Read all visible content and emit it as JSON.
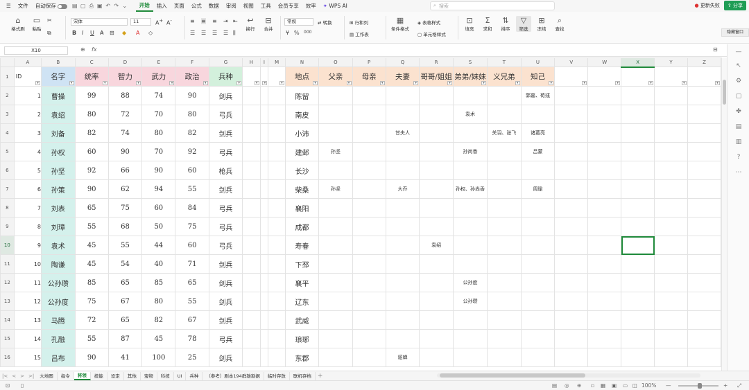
{
  "menubar": {
    "file": "文件",
    "autosave": "自动保存",
    "tabs": [
      "开始",
      "插入",
      "页面",
      "公式",
      "数据",
      "审阅",
      "视图",
      "工具",
      "会员专享",
      "效率"
    ],
    "active_tab": "开始",
    "wps_ai": "WPS AI",
    "search_placeholder": "搜索",
    "update_failed": "更新失败",
    "share": "分享"
  },
  "ribbon": {
    "format_painter": "格式刷",
    "paste": "粘贴",
    "font_name": "宋体",
    "font_size": "11",
    "wrap": "换行",
    "merge": "合并",
    "number_format": "常规",
    "convert": "转换",
    "rows_cols": "行和列",
    "worksheet": "工作表",
    "conditional_format": "条件格式",
    "table_style": "表格样式",
    "cell_style": "单元格样式",
    "fill": "填充",
    "sum": "求和",
    "sort": "排序",
    "filter": "筛选",
    "freeze": "冻结",
    "find": "查找",
    "hidden_window": "隐藏窗口"
  },
  "formula": {
    "namebox": "X10",
    "fx": "fx"
  },
  "columns": [
    "A",
    "B",
    "C",
    "D",
    "E",
    "F",
    "G",
    "H",
    "I",
    "M",
    "N",
    "O",
    "P",
    "Q",
    "R",
    "S",
    "T",
    "U",
    "V",
    "W",
    "X",
    "Y",
    "Z"
  ],
  "headers": {
    "id": "ID",
    "name": "名字",
    "lead": "统率",
    "int": "智力",
    "war": "武力",
    "pol": "政治",
    "troop": "兵种",
    "place": "地点",
    "father": "父亲",
    "mother": "母亲",
    "spouse": "夫妻",
    "elder": "哥哥/姐姐",
    "younger": "弟弟/妹妹",
    "sworn": "义兄弟",
    "confidant": "知己"
  },
  "rows": [
    {
      "r": "2",
      "id": "1",
      "name": "曹操",
      "lead": "99",
      "int": "88",
      "war": "74",
      "pol": "90",
      "troop": "剑兵",
      "place": "陈留",
      "father": "",
      "spouse": "",
      "elder": "",
      "younger": "",
      "sworn": "",
      "confidant": "郭嘉、荀彧"
    },
    {
      "r": "3",
      "id": "2",
      "name": "袁绍",
      "lead": "80",
      "int": "72",
      "war": "70",
      "pol": "80",
      "troop": "弓兵",
      "place": "南皮",
      "father": "",
      "spouse": "",
      "elder": "",
      "younger": "袁术",
      "sworn": "",
      "confidant": ""
    },
    {
      "r": "4",
      "id": "3",
      "name": "刘备",
      "lead": "82",
      "int": "74",
      "war": "80",
      "pol": "82",
      "troop": "剑兵",
      "place": "小沛",
      "father": "",
      "spouse": "甘夫人",
      "elder": "",
      "younger": "",
      "sworn": "关羽、张飞",
      "confidant": "诸葛亮"
    },
    {
      "r": "5",
      "id": "4",
      "name": "孙权",
      "lead": "60",
      "int": "90",
      "war": "70",
      "pol": "92",
      "troop": "弓兵",
      "place": "建邺",
      "father": "孙坚",
      "spouse": "",
      "elder": "",
      "younger": "孙尚香",
      "sworn": "",
      "confidant": "吕蒙"
    },
    {
      "r": "6",
      "id": "5",
      "name": "孙坚",
      "lead": "92",
      "int": "66",
      "war": "90",
      "pol": "60",
      "troop": "枪兵",
      "place": "长沙",
      "father": "",
      "spouse": "",
      "elder": "",
      "younger": "",
      "sworn": "",
      "confidant": ""
    },
    {
      "r": "7",
      "id": "6",
      "name": "孙策",
      "lead": "90",
      "int": "62",
      "war": "94",
      "pol": "55",
      "troop": "剑兵",
      "place": "柴桑",
      "father": "孙坚",
      "spouse": "大乔",
      "elder": "",
      "younger": "孙权、孙尚香",
      "sworn": "",
      "confidant": "周瑜"
    },
    {
      "r": "8",
      "id": "7",
      "name": "刘表",
      "lead": "65",
      "int": "75",
      "war": "60",
      "pol": "84",
      "troop": "弓兵",
      "place": "襄阳",
      "father": "",
      "spouse": "",
      "elder": "",
      "younger": "",
      "sworn": "",
      "confidant": ""
    },
    {
      "r": "9",
      "id": "8",
      "name": "刘璋",
      "lead": "55",
      "int": "68",
      "war": "50",
      "pol": "75",
      "troop": "弓兵",
      "place": "成都",
      "father": "",
      "spouse": "",
      "elder": "",
      "younger": "",
      "sworn": "",
      "confidant": ""
    },
    {
      "r": "10",
      "id": "9",
      "name": "袁术",
      "lead": "45",
      "int": "55",
      "war": "44",
      "pol": "60",
      "troop": "弓兵",
      "place": "寿春",
      "father": "",
      "spouse": "",
      "elder": "袁绍",
      "younger": "",
      "sworn": "",
      "confidant": ""
    },
    {
      "r": "11",
      "id": "10",
      "name": "陶谦",
      "lead": "45",
      "int": "54",
      "war": "40",
      "pol": "71",
      "troop": "剑兵",
      "place": "下邳",
      "father": "",
      "spouse": "",
      "elder": "",
      "younger": "",
      "sworn": "",
      "confidant": ""
    },
    {
      "r": "12",
      "id": "11",
      "name": "公孙瓒",
      "lead": "85",
      "int": "65",
      "war": "85",
      "pol": "65",
      "troop": "剑兵",
      "place": "襄平",
      "father": "",
      "spouse": "",
      "elder": "",
      "younger": "公孙度",
      "sworn": "",
      "confidant": ""
    },
    {
      "r": "13",
      "id": "12",
      "name": "公孙度",
      "lead": "75",
      "int": "67",
      "war": "80",
      "pol": "55",
      "troop": "剑兵",
      "place": "辽东",
      "father": "",
      "spouse": "",
      "elder": "",
      "younger": "公孙瓒",
      "sworn": "",
      "confidant": ""
    },
    {
      "r": "14",
      "id": "13",
      "name": "马腾",
      "lead": "72",
      "int": "65",
      "war": "82",
      "pol": "67",
      "troop": "剑兵",
      "place": "武威",
      "father": "",
      "spouse": "",
      "elder": "",
      "younger": "",
      "sworn": "",
      "confidant": ""
    },
    {
      "r": "15",
      "id": "14",
      "name": "孔融",
      "lead": "55",
      "int": "87",
      "war": "45",
      "pol": "78",
      "troop": "弓兵",
      "place": "琅琊",
      "father": "",
      "spouse": "",
      "elder": "",
      "younger": "",
      "sworn": "",
      "confidant": ""
    },
    {
      "r": "16",
      "id": "15",
      "name": "吕布",
      "lead": "90",
      "int": "41",
      "war": "100",
      "pol": "25",
      "troop": "剑兵",
      "place": "东郡",
      "father": "",
      "spouse": "貂蝉",
      "elder": "",
      "younger": "",
      "sworn": "",
      "confidant": ""
    }
  ],
  "sheet_tabs": [
    "大地图",
    "指令",
    "将领",
    "技能",
    "设定",
    "其他",
    "宝物",
    "科技",
    "UI",
    "兵种",
    "（参考）剧本194群雄割据",
    "临时存放",
    "联机存档"
  ],
  "active_sheet": "将领",
  "status": {
    "zoom": "100%"
  }
}
